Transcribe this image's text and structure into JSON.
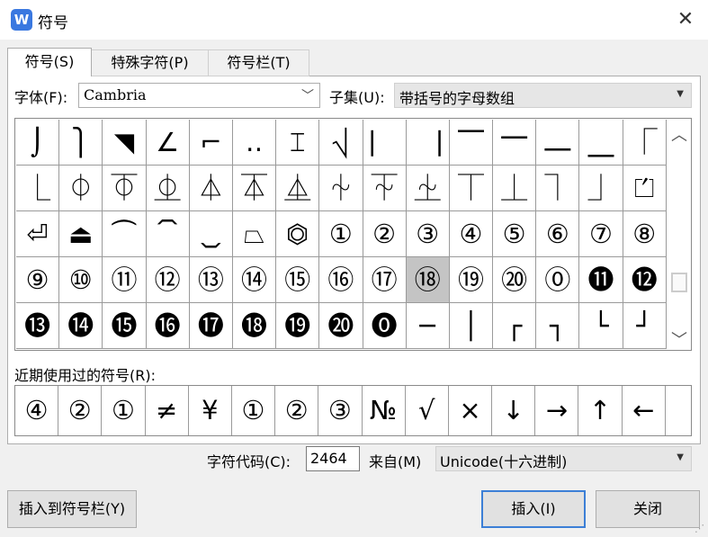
{
  "window": {
    "title": "符号",
    "app_icon": "W",
    "close_icon": "✕"
  },
  "tabs": [
    {
      "label": "符号(S)",
      "active": true
    },
    {
      "label": "特殊字符(P)"
    },
    {
      "label": "符号栏(T)"
    }
  ],
  "font": {
    "label": "字体(F):",
    "value": "Cambria",
    "chevron": "﹀"
  },
  "subset": {
    "label": "子集(U):",
    "value": "带括号的字母数组",
    "arrow": "▼"
  },
  "grid": {
    "selected_index": 54,
    "cells": [
      "⌡",
      "⎫",
      "◥",
      "∠",
      "⌐",
      "‥",
      "⌶",
      "⎷",
      "⎸",
      "⎹",
      "⎺",
      "⎻",
      "⎼",
      "⎽",
      "⎾",
      "⎿",
      "⏀",
      "⏁",
      "⏂",
      "⏃",
      "⏄",
      "⏅",
      "⏆",
      "⏇",
      "⏈",
      "⏉",
      "⏊",
      "⏋",
      "⏌",
      "⏍",
      "⏎",
      "⏏",
      "⏜",
      "⏠",
      "⏡",
      "⏢",
      "⏣",
      "①",
      "②",
      "③",
      "④",
      "⑤",
      "⑥",
      "⑦",
      "⑧",
      "⑨",
      "⑩",
      "⑪",
      "⑫",
      "⑬",
      "⑭",
      "⑮",
      "⑯",
      "⑰",
      "⑱",
      "⑲",
      "⑳",
      "⓪",
      "⓫",
      "⓬",
      "⓭",
      "⓮",
      "⓯",
      "⓰",
      "⓱",
      "⓲",
      "⓳",
      "⓴",
      "⓿",
      "─",
      "│",
      "┌",
      "┐",
      "└",
      "┘"
    ]
  },
  "scroll": {
    "up": "︿",
    "down": "﹀"
  },
  "recent": {
    "label": "近期使用过的符号(R):",
    "cells": [
      "④",
      "②",
      "①",
      "≠",
      "¥",
      "①",
      "②",
      "③",
      "№",
      "√",
      "×",
      "↓",
      "→",
      "↑",
      "←"
    ]
  },
  "code": {
    "label": "字符代码(C):",
    "value": "2464",
    "from_label": "来自(M)",
    "from_value": "Unicode(十六进制)",
    "from_arrow": "▼"
  },
  "buttons": {
    "insert_to_bar": "插入到符号栏(Y)",
    "insert": "插入(I)",
    "close": "关闭"
  }
}
